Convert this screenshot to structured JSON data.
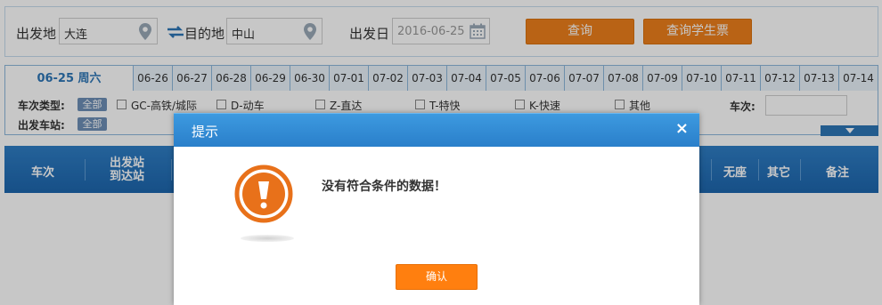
{
  "search": {
    "from_label": "出发地",
    "from_value": "大连",
    "to_label": "目的地",
    "to_value": "中山",
    "date_label": "出发日",
    "date_value": "2016-06-25",
    "query_button": "查询",
    "student_button": "查询学生票"
  },
  "tabs": {
    "active": "06-25 周六",
    "dates": [
      "06-26",
      "06-27",
      "06-28",
      "06-29",
      "06-30",
      "07-01",
      "07-02",
      "07-03",
      "07-04",
      "07-05",
      "07-06",
      "07-07",
      "07-08",
      "07-09",
      "07-10",
      "07-11",
      "07-12",
      "07-13",
      "07-14"
    ]
  },
  "filters": {
    "type_label": "车次类型:",
    "all_label": "全部",
    "station_label": "出发车站:",
    "station_all_label": "全部",
    "types": [
      "GC-高铁/城际",
      "D-动车",
      "Z-直达",
      "T-特快",
      "K-快速",
      "其他"
    ],
    "train_no_label": "车次:"
  },
  "table_header": {
    "train_no": "车次",
    "depart_station": "出发站",
    "arrive_station": "到达站",
    "standing": "无座",
    "other": "其它",
    "remark": "备注"
  },
  "dialog": {
    "title": "提示",
    "close": "×",
    "message": "没有符合条件的数据！",
    "ok_button": "确认"
  },
  "colors": {
    "accent_orange": "#ee7f1b",
    "header_blue": "#2a7fca",
    "warning_orange": "#e8711a"
  }
}
